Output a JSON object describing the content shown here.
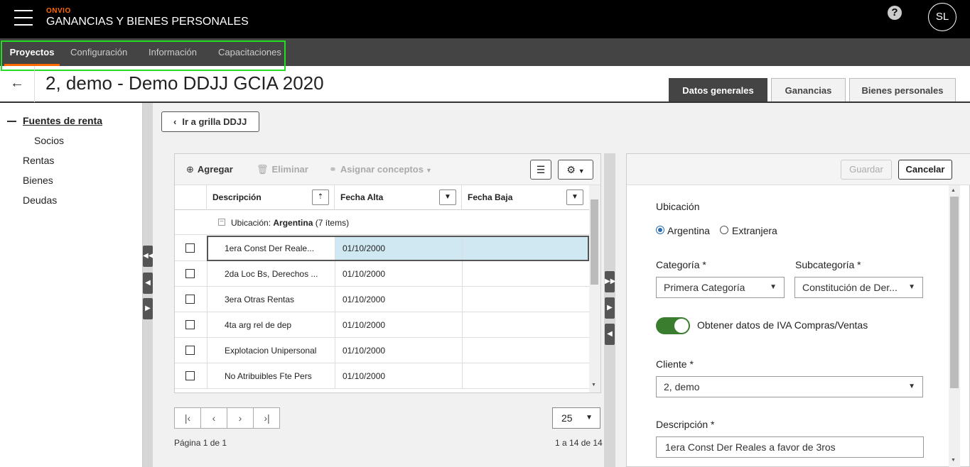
{
  "header": {
    "brand": "ONVIO",
    "app_title": "GANANCIAS Y BIENES PERSONALES",
    "help_icon": "help-icon",
    "avatar_initials": "SL"
  },
  "nav": {
    "items": [
      {
        "label": "Proyectos",
        "active": true
      },
      {
        "label": "Configuración"
      },
      {
        "label": "Información"
      },
      {
        "label": "Capacitaciones"
      }
    ]
  },
  "title_row": {
    "back_icon": "←",
    "page_title": "2, demo - Demo DDJJ GCIA 2020",
    "tabs": [
      "Datos generales",
      "Ganancias",
      "Bienes personales"
    ]
  },
  "sidebar": {
    "items": [
      "Fuentes de renta",
      "Socios",
      "Rentas",
      "Bienes",
      "Deudas"
    ]
  },
  "content": {
    "back_button": "Ir a grilla DDJJ"
  },
  "grid": {
    "toolbar": {
      "add": "Agregar",
      "delete": "Eliminar",
      "assign": "Asignar conceptos"
    },
    "columns": [
      "Descripción",
      "Fecha Alta",
      "Fecha Baja"
    ],
    "group": {
      "label": "Ubicación:",
      "value": "Argentina",
      "count": "(7 ítems)"
    },
    "rows": [
      {
        "desc": "1era Const Der Reale...",
        "alta": "01/10/2000",
        "baja": ""
      },
      {
        "desc": "2da Loc Bs, Derechos ...",
        "alta": "01/10/2000",
        "baja": ""
      },
      {
        "desc": "3era Otras Rentas",
        "alta": "01/10/2000",
        "baja": ""
      },
      {
        "desc": "4ta arg rel de dep",
        "alta": "01/10/2000",
        "baja": ""
      },
      {
        "desc": "Explotacion Unipersonal",
        "alta": "01/10/2000",
        "baja": ""
      },
      {
        "desc": "No Atribuibles Fte Pers",
        "alta": "01/10/2000",
        "baja": ""
      }
    ],
    "page_size": "25",
    "page_info": "Página 1 de 1",
    "range_info": "1 a 14 de 14"
  },
  "form": {
    "save": "Guardar",
    "cancel": "Cancelar",
    "ubicacion_label": "Ubicación",
    "radio_argentina": "Argentina",
    "radio_extranjera": "Extranjera",
    "categoria_label": "Categoría *",
    "categoria_value": "Primera Categoría",
    "subcategoria_label": "Subcategoría *",
    "subcategoria_value": "Constitución de Der...",
    "toggle_label": "Obtener datos de IVA Compras/Ventas",
    "cliente_label": "Cliente *",
    "cliente_value": "2, demo",
    "descripcion_label": "Descripción *",
    "descripcion_value": "1era Const Der Reales a favor de 3ros"
  },
  "colors": {
    "accent": "#ff6a00",
    "toggle_on": "#3a7d2e",
    "selected_row": "#d0e8f2",
    "highlight_box": "#22dd22"
  }
}
